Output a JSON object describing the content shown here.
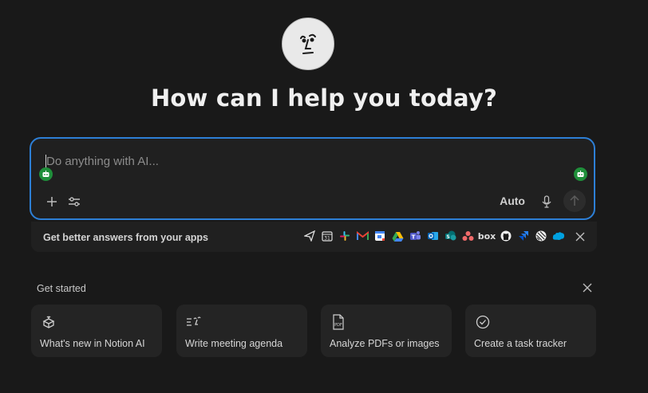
{
  "header": {
    "title": "How can I help you today?"
  },
  "composer": {
    "placeholder": "Do anything with AI...",
    "mode_label": "Auto"
  },
  "apps_bar": {
    "label": "Get better answers from your apps",
    "apps": [
      "send-icon",
      "calendar-icon",
      "slack-icon",
      "gmail-icon",
      "google-calendar-icon",
      "google-drive-icon",
      "teams-icon",
      "outlook-icon",
      "sharepoint-icon",
      "asana-icon",
      "box-logo",
      "github-icon",
      "jira-icon",
      "linear-icon",
      "salesforce-icon"
    ],
    "box_text": "box"
  },
  "get_started": {
    "label": "Get started",
    "cards": [
      {
        "label": "What's new in Notion AI",
        "icon": "gift-box-icon"
      },
      {
        "label": "Write meeting agenda",
        "icon": "write-ai-icon"
      },
      {
        "label": "Analyze PDFs or images",
        "icon": "pdf-file-icon"
      },
      {
        "label": "Create a task tracker",
        "icon": "check-circle-icon"
      }
    ]
  },
  "colors": {
    "accent": "#2d7fd6",
    "bot": "#1f8f3a",
    "background": "#191919"
  }
}
